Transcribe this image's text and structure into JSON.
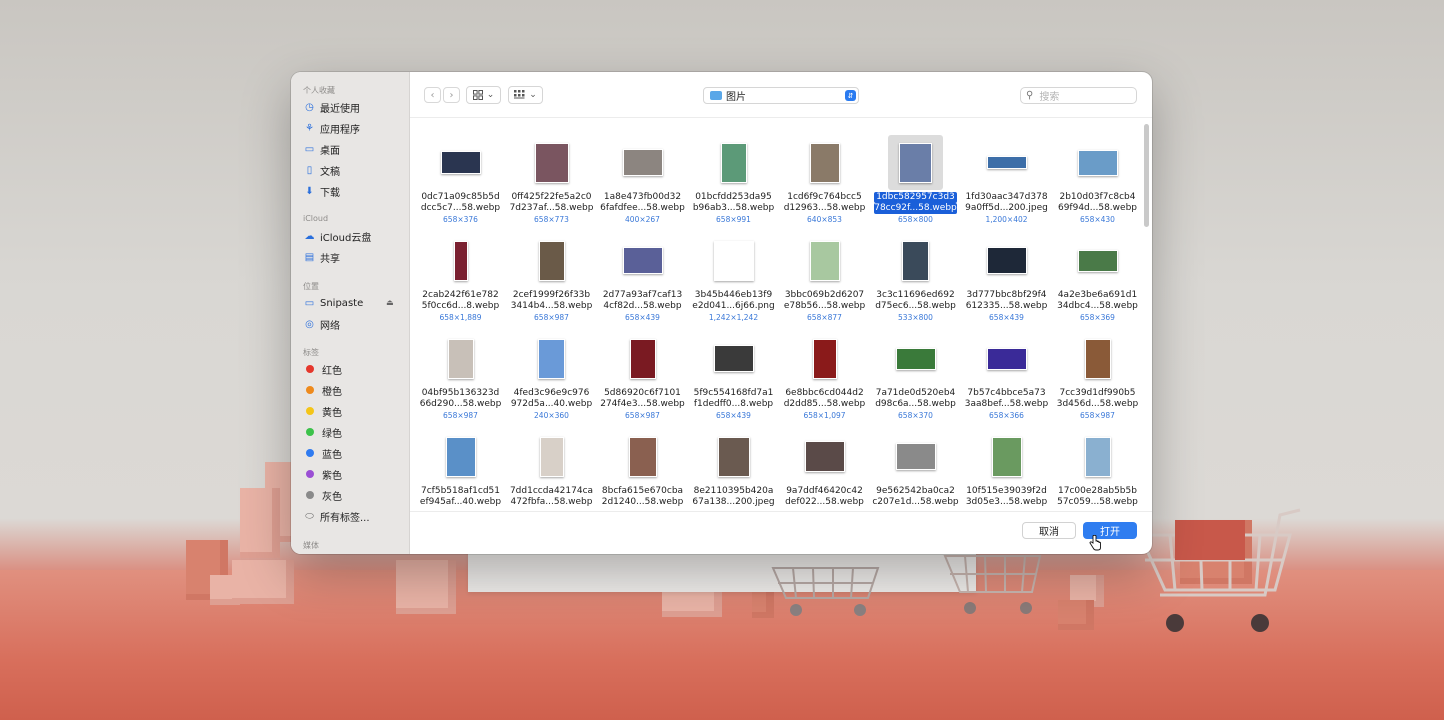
{
  "sidebar": {
    "favorites_heading": "个人收藏",
    "favorites": [
      {
        "label": "最近使用",
        "icon": "clock-icon"
      },
      {
        "label": "应用程序",
        "icon": "apps-icon"
      },
      {
        "label": "桌面",
        "icon": "desktop-icon"
      },
      {
        "label": "文稿",
        "icon": "document-icon"
      },
      {
        "label": "下载",
        "icon": "download-icon"
      }
    ],
    "icloud_heading": "iCloud",
    "icloud": [
      {
        "label": "iCloud云盘",
        "icon": "cloud-icon"
      },
      {
        "label": "共享",
        "icon": "shared-folder-icon"
      }
    ],
    "locations_heading": "位置",
    "locations": [
      {
        "label": "Snipaste",
        "icon": "drive-icon"
      },
      {
        "label": "网络",
        "icon": "network-icon"
      }
    ],
    "tags_heading": "标签",
    "tags": [
      {
        "label": "红色",
        "color": "#e5372c"
      },
      {
        "label": "橙色",
        "color": "#ee8a1c"
      },
      {
        "label": "黄色",
        "color": "#f4c518"
      },
      {
        "label": "绿色",
        "color": "#3cc24a"
      },
      {
        "label": "蓝色",
        "color": "#2f7bf0"
      },
      {
        "label": "紫色",
        "color": "#9b4fd4"
      },
      {
        "label": "灰色",
        "color": "#8a8a8a"
      }
    ],
    "all_tags": "所有标签...",
    "media_heading": "媒体"
  },
  "toolbar": {
    "back_icon": "chevron-left-icon",
    "forward_icon": "chevron-right-icon",
    "view_icon": "grid-view-icon",
    "group_icon": "group-view-icon",
    "folder": "图片",
    "search_placeholder": "搜索"
  },
  "files": [
    {
      "name1": "0dc71a09c85b5d",
      "name2": "dcc5c7...58.webp",
      "dim": "658×376",
      "color": "#2a3550",
      "aspect": 1.75
    },
    {
      "name1": "0ff425f22fe5a2c0",
      "name2": "7d237af...58.webp",
      "dim": "658×773",
      "color": "#7a5560",
      "aspect": 0.85
    },
    {
      "name1": "1a8e473fb00d32",
      "name2": "6fafdfee...58.webp",
      "dim": "400×267",
      "color": "#8c8580",
      "aspect": 1.5
    },
    {
      "name1": "01bcfdd253da95",
      "name2": "b96ab3...58.webp",
      "dim": "658×991",
      "color": "#5c9a78",
      "aspect": 0.66
    },
    {
      "name1": "1cd6f9c764bcc5",
      "name2": "d12963...58.webp",
      "dim": "640×853",
      "color": "#8a7a68",
      "aspect": 0.75
    },
    {
      "name1": "1dbc582957c3d3",
      "name2": "78cc92f...58.webp",
      "dim": "658×800",
      "color": "#6a7ea8",
      "aspect": 0.82,
      "selected": true
    },
    {
      "name1": "1fd30aac347d378",
      "name2": "9a0ff5d...200.jpeg",
      "dim": "1,200×402",
      "color": "#3d6ea8",
      "aspect": 2.98
    },
    {
      "name1": "2b10d03f7c8cb4",
      "name2": "69f94d...58.webp",
      "dim": "658×430",
      "color": "#6a9cc8",
      "aspect": 1.53
    },
    {
      "name1": "2cab242f61e782",
      "name2": "5f0cc6d...8.webp",
      "dim": "658×1,889",
      "color": "#7a2030",
      "aspect": 0.35
    },
    {
      "name1": "2cef1999f26f33b",
      "name2": "3414b4...58.webp",
      "dim": "658×987",
      "color": "#6a5a48",
      "aspect": 0.66
    },
    {
      "name1": "2d77a93af7caf13",
      "name2": "4cf82d...58.webp",
      "dim": "658×439",
      "color": "#5a6098",
      "aspect": 1.5
    },
    {
      "name1": "3b45b446eb13f9",
      "name2": "e2d041...6j66.png",
      "dim": "1,242×1,242",
      "color": "#ffffff",
      "aspect": 1.0
    },
    {
      "name1": "3bbc069b2d6207",
      "name2": "e78b56...58.webp",
      "dim": "658×877",
      "color": "#a8c8a0",
      "aspect": 0.75
    },
    {
      "name1": "3c3c11696ed692",
      "name2": "d75ec6...58.webp",
      "dim": "533×800",
      "color": "#3a4a5a",
      "aspect": 0.67
    },
    {
      "name1": "3d777bbc8bf29f4",
      "name2": "612335...58.webp",
      "dim": "658×439",
      "color": "#1e2838",
      "aspect": 1.5
    },
    {
      "name1": "4a2e3be6a691d1",
      "name2": "34dbc4...58.webp",
      "dim": "658×369",
      "color": "#4a7a48",
      "aspect": 1.78
    },
    {
      "name1": "04bf95b136323d",
      "name2": "66d290...58.webp",
      "dim": "658×987",
      "color": "#c8c0b8",
      "aspect": 0.66
    },
    {
      "name1": "4fed3c96e9c976",
      "name2": "972d5a...40.webp",
      "dim": "240×360",
      "color": "#6a9ad8",
      "aspect": 0.67
    },
    {
      "name1": "5d86920c6f7101",
      "name2": "274f4e3...58.webp",
      "dim": "658×987",
      "color": "#7a1a22",
      "aspect": 0.66
    },
    {
      "name1": "5f9c554168fd7a1",
      "name2": "f1dedff0...8.webp",
      "dim": "658×439",
      "color": "#3a3a3a",
      "aspect": 1.5
    },
    {
      "name1": "6e8bbc6cd044d2",
      "name2": "d2dd85...58.webp",
      "dim": "658×1,097",
      "color": "#8a1a1a",
      "aspect": 0.6
    },
    {
      "name1": "7a71de0d520eb4",
      "name2": "d98c6a...58.webp",
      "dim": "658×370",
      "color": "#3a7a3a",
      "aspect": 1.78
    },
    {
      "name1": "7b57c4bbce5a73",
      "name2": "3aa8bef...58.webp",
      "dim": "658×366",
      "color": "#3a2a98",
      "aspect": 1.8
    },
    {
      "name1": "7cc39d1df990b5",
      "name2": "3d456d...58.webp",
      "dim": "658×987",
      "color": "#8a5a38",
      "aspect": 0.66
    },
    {
      "name1": "7cf5b518af1cd51",
      "name2": "ef945af...40.webp",
      "dim": "",
      "color": "#5a90c8",
      "aspect": 0.75
    },
    {
      "name1": "7dd1ccda42174ca",
      "name2": "472fbfa...58.webp",
      "dim": "",
      "color": "#d8d0c8",
      "aspect": 0.6
    },
    {
      "name1": "8bcfa615e670cba",
      "name2": "2d1240...58.webp",
      "dim": "",
      "color": "#8a6050",
      "aspect": 0.7
    },
    {
      "name1": "8e2110395b420a",
      "name2": "67a138...200.jpeg",
      "dim": "",
      "color": "#6a5a50",
      "aspect": 0.8
    },
    {
      "name1": "9a7ddf46420c42",
      "name2": "def022...58.webp",
      "dim": "",
      "color": "#5a4a48",
      "aspect": 1.3
    },
    {
      "name1": "9e562542ba0ca2",
      "name2": "c207e1d...58.webp",
      "dim": "",
      "color": "#8a8a8a",
      "aspect": 1.5
    },
    {
      "name1": "10f515e39039f2d",
      "name2": "3d05e3...58.webp",
      "dim": "",
      "color": "#6a9a60",
      "aspect": 0.75
    },
    {
      "name1": "17c00e28ab5b5b",
      "name2": "57c059...58.webp",
      "dim": "",
      "color": "#8ab0d0",
      "aspect": 0.66
    }
  ],
  "footer": {
    "cancel": "取消",
    "open": "打开"
  }
}
